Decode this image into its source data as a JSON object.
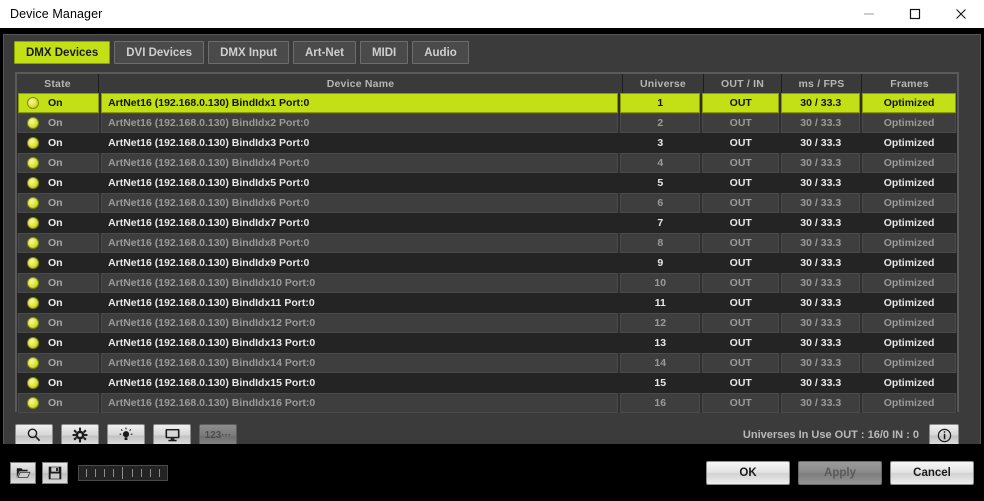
{
  "window": {
    "title": "Device Manager",
    "controls": {
      "minimize": "minimize-icon",
      "maximize": "maximize-icon",
      "close": "close-icon"
    }
  },
  "tabs": [
    {
      "label": "DMX Devices",
      "active": true
    },
    {
      "label": "DVI Devices",
      "active": false
    },
    {
      "label": "DMX Input",
      "active": false
    },
    {
      "label": "Art-Net",
      "active": false
    },
    {
      "label": "MIDI",
      "active": false
    },
    {
      "label": "Audio",
      "active": false
    }
  ],
  "table": {
    "columns": [
      "State",
      "Device Name",
      "Universe",
      "OUT / IN",
      "ms / FPS",
      "Frames"
    ],
    "rows": [
      {
        "state": "On",
        "name": "ArtNet16 (192.168.0.130) BindIdx1 Port:0",
        "universe": "1",
        "outin": "OUT",
        "msfps": "30 / 33.3",
        "frames": "Optimized",
        "selected": true
      },
      {
        "state": "On",
        "name": "ArtNet16 (192.168.0.130) BindIdx2 Port:0",
        "universe": "2",
        "outin": "OUT",
        "msfps": "30 / 33.3",
        "frames": "Optimized",
        "selected": false
      },
      {
        "state": "On",
        "name": "ArtNet16 (192.168.0.130) BindIdx3 Port:0",
        "universe": "3",
        "outin": "OUT",
        "msfps": "30 / 33.3",
        "frames": "Optimized",
        "selected": false
      },
      {
        "state": "On",
        "name": "ArtNet16 (192.168.0.130) BindIdx4 Port:0",
        "universe": "4",
        "outin": "OUT",
        "msfps": "30 / 33.3",
        "frames": "Optimized",
        "selected": false
      },
      {
        "state": "On",
        "name": "ArtNet16 (192.168.0.130) BindIdx5 Port:0",
        "universe": "5",
        "outin": "OUT",
        "msfps": "30 / 33.3",
        "frames": "Optimized",
        "selected": false
      },
      {
        "state": "On",
        "name": "ArtNet16 (192.168.0.130) BindIdx6 Port:0",
        "universe": "6",
        "outin": "OUT",
        "msfps": "30 / 33.3",
        "frames": "Optimized",
        "selected": false
      },
      {
        "state": "On",
        "name": "ArtNet16 (192.168.0.130) BindIdx7 Port:0",
        "universe": "7",
        "outin": "OUT",
        "msfps": "30 / 33.3",
        "frames": "Optimized",
        "selected": false
      },
      {
        "state": "On",
        "name": "ArtNet16 (192.168.0.130) BindIdx8 Port:0",
        "universe": "8",
        "outin": "OUT",
        "msfps": "30 / 33.3",
        "frames": "Optimized",
        "selected": false
      },
      {
        "state": "On",
        "name": "ArtNet16 (192.168.0.130) BindIdx9 Port:0",
        "universe": "9",
        "outin": "OUT",
        "msfps": "30 / 33.3",
        "frames": "Optimized",
        "selected": false
      },
      {
        "state": "On",
        "name": "ArtNet16 (192.168.0.130) BindIdx10 Port:0",
        "universe": "10",
        "outin": "OUT",
        "msfps": "30 / 33.3",
        "frames": "Optimized",
        "selected": false
      },
      {
        "state": "On",
        "name": "ArtNet16 (192.168.0.130) BindIdx11 Port:0",
        "universe": "11",
        "outin": "OUT",
        "msfps": "30 / 33.3",
        "frames": "Optimized",
        "selected": false
      },
      {
        "state": "On",
        "name": "ArtNet16 (192.168.0.130) BindIdx12 Port:0",
        "universe": "12",
        "outin": "OUT",
        "msfps": "30 / 33.3",
        "frames": "Optimized",
        "selected": false
      },
      {
        "state": "On",
        "name": "ArtNet16 (192.168.0.130) BindIdx13 Port:0",
        "universe": "13",
        "outin": "OUT",
        "msfps": "30 / 33.3",
        "frames": "Optimized",
        "selected": false
      },
      {
        "state": "On",
        "name": "ArtNet16 (192.168.0.130) BindIdx14 Port:0",
        "universe": "14",
        "outin": "OUT",
        "msfps": "30 / 33.3",
        "frames": "Optimized",
        "selected": false
      },
      {
        "state": "On",
        "name": "ArtNet16 (192.168.0.130) BindIdx15 Port:0",
        "universe": "15",
        "outin": "OUT",
        "msfps": "30 / 33.3",
        "frames": "Optimized",
        "selected": false
      },
      {
        "state": "On",
        "name": "ArtNet16 (192.168.0.130) BindIdx16 Port:0",
        "universe": "16",
        "outin": "OUT",
        "msfps": "30 / 33.3",
        "frames": "Optimized",
        "selected": false
      }
    ]
  },
  "toolbar": {
    "buttons": [
      {
        "icon": "search-icon",
        "label": "",
        "disabled": false
      },
      {
        "icon": "gear-icon",
        "label": "",
        "disabled": false
      },
      {
        "icon": "lightbulb-icon",
        "label": "",
        "disabled": false
      },
      {
        "icon": "monitor-icon",
        "label": "",
        "disabled": false
      },
      {
        "icon": "numeric-icon",
        "label": "123···",
        "disabled": true
      }
    ],
    "status": "Universes In Use OUT : 16/0  IN : 0",
    "info_icon": "info-icon"
  },
  "footer": {
    "open_icon": "folder-open-icon",
    "save_icon": "save-icon",
    "ok_label": "OK",
    "apply_label": "Apply",
    "cancel_label": "Cancel",
    "apply_disabled": true
  },
  "colors": {
    "accent": "#c3e016",
    "panel": "#3b3b3b",
    "table_bg": "#2b2b2b",
    "row_even": "#3e3e3e",
    "row_odd": "#242424",
    "led": "#e4ea55"
  }
}
